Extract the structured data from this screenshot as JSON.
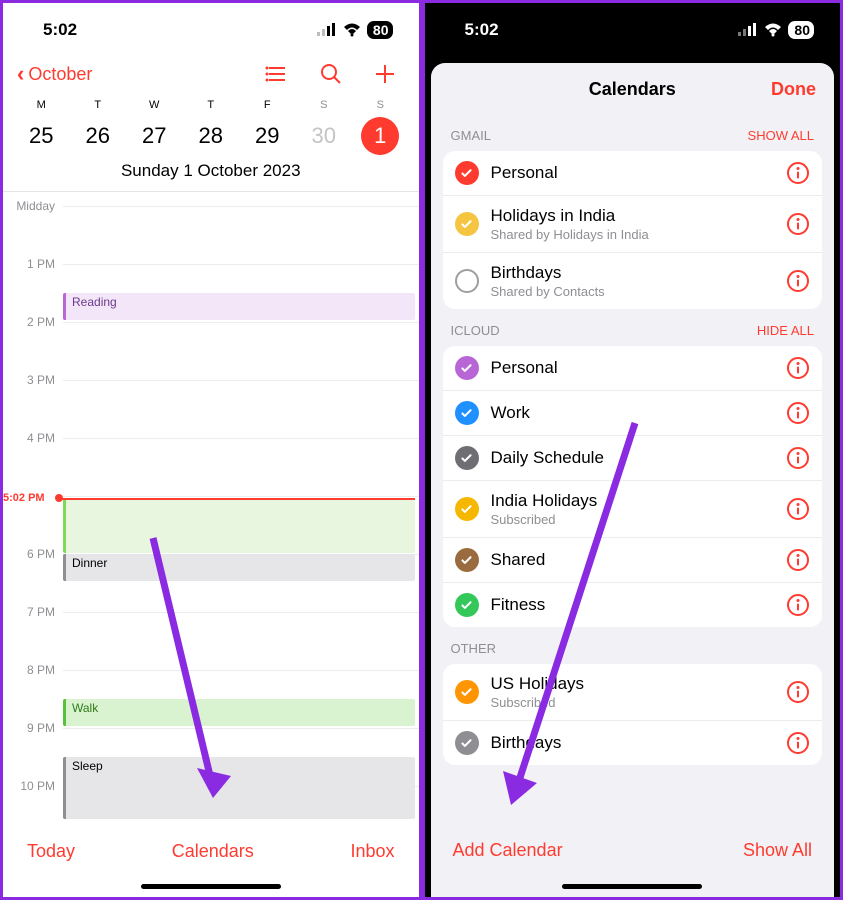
{
  "status": {
    "time": "5:02",
    "battery": "80"
  },
  "left": {
    "backLabel": "October",
    "days": [
      {
        "dw": "M",
        "dn": "25"
      },
      {
        "dw": "T",
        "dn": "26"
      },
      {
        "dw": "W",
        "dn": "27"
      },
      {
        "dw": "T",
        "dn": "28"
      },
      {
        "dw": "F",
        "dn": "29"
      },
      {
        "dw": "S",
        "dn": "30",
        "gray": true,
        "weekend": true
      },
      {
        "dw": "S",
        "dn": "1",
        "sel": true,
        "weekend": true
      }
    ],
    "fullDate": "Sunday  1 October 2023",
    "midday": "Midday",
    "hours": [
      "1 PM",
      "2 PM",
      "3 PM",
      "4 PM",
      "",
      "6 PM",
      "7 PM",
      "8 PM",
      "9 PM",
      "10 PM"
    ],
    "nowLabel": "5:02 PM",
    "events": {
      "reading": "Reading",
      "dinner": "Dinner",
      "walk": "Walk",
      "sleep": "Sleep"
    },
    "bottom": {
      "today": "Today",
      "calendars": "Calendars",
      "inbox": "Inbox"
    }
  },
  "right": {
    "title": "Calendars",
    "done": "Done",
    "sections": {
      "gmail": {
        "header": "GMAIL",
        "action": "SHOW ALL"
      },
      "icloud": {
        "header": "ICLOUD",
        "action": "HIDE ALL"
      },
      "other": {
        "header": "OTHER"
      }
    },
    "gmail": [
      {
        "name": "Personal",
        "color": "#ff3b30",
        "checked": true
      },
      {
        "name": "Holidays in India",
        "sub": "Shared by Holidays in India",
        "color": "#f5c542",
        "checked": true
      },
      {
        "name": "Birthdays",
        "sub": "Shared by Contacts",
        "color": "#9e9e9e",
        "checked": false,
        "hollow": true
      }
    ],
    "icloud": [
      {
        "name": "Personal",
        "color": "#b865d6",
        "checked": true
      },
      {
        "name": "Work",
        "color": "#1e90ff",
        "checked": true
      },
      {
        "name": "Daily Schedule",
        "color": "#6e6e73",
        "checked": true
      },
      {
        "name": "India Holidays",
        "sub": "Subscribed",
        "color": "#f5b700",
        "checked": true
      },
      {
        "name": "Shared",
        "color": "#9a6b3f",
        "checked": true
      },
      {
        "name": "Fitness",
        "color": "#34c759",
        "checked": true
      }
    ],
    "other": [
      {
        "name": "US Holidays",
        "sub": "Subscribed",
        "color": "#ff9500",
        "checked": true
      },
      {
        "name": "Birthdays",
        "color": "#8e8e93",
        "checked": true,
        "partial": true
      }
    ],
    "bottom": {
      "add": "Add Calendar",
      "showAll": "Show All"
    }
  }
}
